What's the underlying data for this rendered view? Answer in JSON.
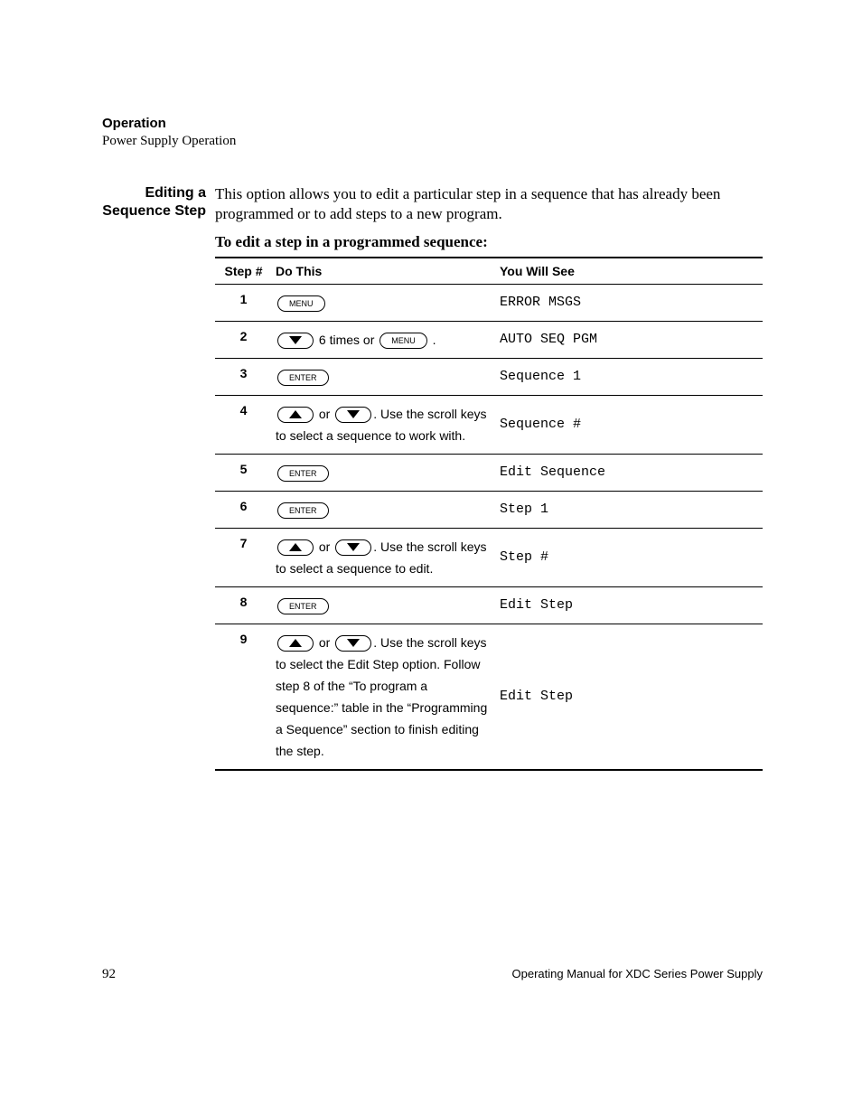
{
  "header": {
    "title": "Operation",
    "subtitle": "Power Supply Operation"
  },
  "side_label": "Editing a Sequence Step",
  "intro": "This option allows you to edit a particular step in a sequence that has already been programmed or to add steps to a new program.",
  "sub_heading": "To edit a step in a programmed sequence:",
  "table": {
    "headers": {
      "step": "Step #",
      "do": "Do This",
      "see": "You Will See"
    },
    "buttons": {
      "menu": "MENU",
      "enter": "ENTER"
    },
    "rows": [
      {
        "n": "1",
        "see": "ERROR MSGS"
      },
      {
        "n": "2",
        "text_mid": " 6 times or ",
        "text_end": " .",
        "see": "AUTO SEQ PGM"
      },
      {
        "n": "3",
        "see": "Sequence 1"
      },
      {
        "n": "4",
        "text_or": " or ",
        "text_after": ". Use the scroll keys to select a sequence to work with.",
        "see": "Sequence #"
      },
      {
        "n": "5",
        "see": "Edit Sequence"
      },
      {
        "n": "6",
        "see": "Step 1"
      },
      {
        "n": "7",
        "text_or": " or ",
        "text_after": ". Use the scroll keys to select a sequence to edit.",
        "see": "Step #"
      },
      {
        "n": "8",
        "see": "Edit Step"
      },
      {
        "n": "9",
        "text_or": " or ",
        "text_after": ". Use the scroll keys to select the Edit Step option. Follow step 8 of the “To program a sequence:” table in the “Programming a Sequence” section to finish editing the step.",
        "see": "Edit Step"
      }
    ]
  },
  "footer": {
    "page": "92",
    "doc": "Operating Manual for XDC Series Power Supply"
  }
}
